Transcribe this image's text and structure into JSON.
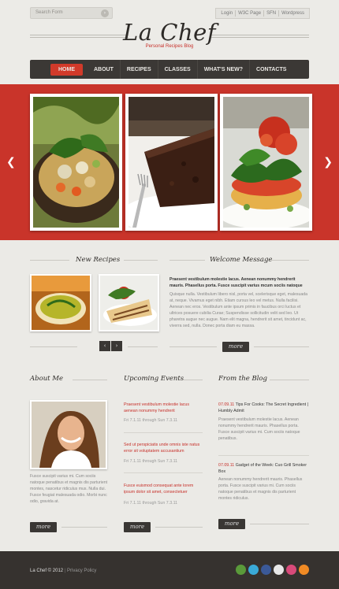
{
  "search": {
    "placeholder": "Search Form"
  },
  "toplinks": [
    "Login",
    "W3C Page",
    "SFN",
    "Wordpress"
  ],
  "logo": {
    "title": "La Chef",
    "subtitle": "Personal Recipes Blog"
  },
  "nav": [
    "HOME",
    "ABOUT",
    "RECIPES",
    "CLASSES",
    "WHAT'S NEW?",
    "CONTACTS"
  ],
  "new_recipes": {
    "title": "New Recipes"
  },
  "welcome": {
    "title": "Welcome Message",
    "lead": "Praesent vestibulum molestie lacus. Aenean nonummy hendrerit mauris. Phasellus porta. Fusce suscipit varius mcum sociis natoque",
    "body": "Quisque nulla. Vestibulum libero nisl, porta vel, scelerisque eget, malesuada at, neque. Vivamus eget nibh. Etiam cursus leo vel metus. Nulla facilisi. Aenean nec eros. Vestibulum ante ipsum primis in faucibus orci luctus et ultrices posuere cubilia Curae; Suspendisse sollicitudin velit sed leo. Ut pharetra augue nec augue. Nam elit magna, hendrerit sit amet, tincidunt ac, viverra sed, nulla. Donec porta diam eu massa.",
    "more": "more"
  },
  "about": {
    "title": "About Me",
    "text": "Fusce suscipit varius mi. Cum sociis natoque penatibus et magnis dis parturient montes, nascetur ridiculus mus. Nulla dui. Fusce feugiat malesuada odio. Morbi nunc odio, gravida at.",
    "more": "more"
  },
  "events": {
    "title": "Upcoming Events",
    "items": [
      {
        "title": "Praesent vestibulum molestie lacus aenean nonummy hendrerit",
        "date": "Fri 7.1.11 through Sun 7.3.11"
      },
      {
        "title": "Sed ut perspiciatis unde omnis iste natus error sit voluptatem accusantium",
        "date": "Fri 7.1.11 through Sun 7.3.11"
      },
      {
        "title": "Fusce euismod consequat ante lorem ipsum dolor sit amet, consectetuer",
        "date": "Fri 7.1.11 through Sun 7.3.11"
      }
    ],
    "more": "more"
  },
  "blog": {
    "title": "From the Blog",
    "posts": [
      {
        "date": "07.09.11",
        "title": "Tips For Cooks: The Secret Ingredient | Humbly Admit",
        "text": "Praesent vestibulum molestie lacus. Aenean nonummy hendrerit mauris. Phasellus porta. Fusce suscipit varius mi. Cum sociis natoque penatibus."
      },
      {
        "date": "07.09.11",
        "title": "Gadget of the Week: Cuo Grill Smoker Box",
        "text": "Aenean nonummy hendrerit mauris. Phasellus porta. Fusce suscipit varius mi. Cum sociis natoque penatibus et magnis dis parturient montes ridiculus."
      }
    ],
    "more": "more"
  },
  "footer": {
    "copyright": "La Chef © 2012",
    "privacy": "Privacy Policy"
  },
  "social_icons": [
    "picasa-icon",
    "twitter-icon",
    "facebook-icon",
    "flickr-icon",
    "dribbble-icon",
    "rss-icon"
  ],
  "colors": {
    "accent": "#d13a2a",
    "dark": "#36322f",
    "background": "#ebeae6"
  }
}
